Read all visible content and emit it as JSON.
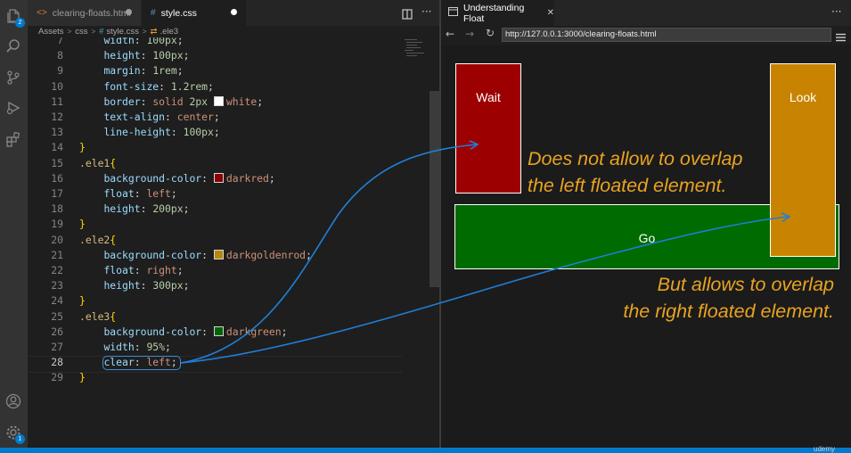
{
  "editor": {
    "tabs": [
      {
        "label": "clearing-floats.html",
        "icon": "html-file-icon",
        "dirty": true
      },
      {
        "label": "style.css",
        "icon": "css-file-icon",
        "dirty": true
      }
    ],
    "breadcrumb": [
      "Assets",
      "css",
      "style.css",
      ".ele3"
    ],
    "lines": [
      {
        "n": "7",
        "text": "    width: 100px;"
      },
      {
        "n": "8",
        "text": "    height: 100px;"
      },
      {
        "n": "9",
        "text": "    margin: 1rem;"
      },
      {
        "n": "10",
        "text": "    font-size: 1.2rem;"
      },
      {
        "n": "11",
        "text": "    border: solid 2px white;"
      },
      {
        "n": "12",
        "text": "    text-align: center;"
      },
      {
        "n": "13",
        "text": "    line-height: 100px;"
      },
      {
        "n": "14",
        "text": "}"
      },
      {
        "n": "15",
        "text": ".ele1{"
      },
      {
        "n": "16",
        "text": "    background-color: darkred;"
      },
      {
        "n": "17",
        "text": "    float: left;"
      },
      {
        "n": "18",
        "text": "    height: 200px;"
      },
      {
        "n": "19",
        "text": "}"
      },
      {
        "n": "20",
        "text": ".ele2{"
      },
      {
        "n": "21",
        "text": "    background-color: darkgoldenrod;"
      },
      {
        "n": "22",
        "text": "    float: right;"
      },
      {
        "n": "23",
        "text": "    height: 300px;"
      },
      {
        "n": "24",
        "text": "}"
      },
      {
        "n": "25",
        "text": ".ele3{"
      },
      {
        "n": "26",
        "text": "    background-color: darkgreen;"
      },
      {
        "n": "27",
        "text": "    width: 95%;"
      },
      {
        "n": "28",
        "text": "    clear: left;"
      },
      {
        "n": "29",
        "text": "}"
      }
    ],
    "current_line": "28",
    "swatch_colors": {
      "white": "#ffffff",
      "darkred": "#8b0000",
      "darkgoldenrod": "#b8860b",
      "darkgreen": "#006400"
    }
  },
  "activity_bar": {
    "explorer_badge": "2",
    "settings_badge": "1"
  },
  "browser": {
    "tab_title": "Understanding Float",
    "url": "http://127.0.0.1:3000/clearing-floats.html",
    "boxes": {
      "ele1": {
        "label": "Wait",
        "color": "#9d0000"
      },
      "ele2": {
        "label": "Look",
        "color": "#c88400"
      },
      "ele3": {
        "label": "Go",
        "color": "#006b00"
      }
    }
  },
  "annotations": {
    "note1_line1": "Does not allow to overlap",
    "note1_line2": "the left floated element.",
    "note2_line1": "But allows to overlap",
    "note2_line2": "the right floated element.",
    "color": "#e8a320",
    "arrow_color": "#1f7fd6"
  },
  "watermark": "udemy"
}
